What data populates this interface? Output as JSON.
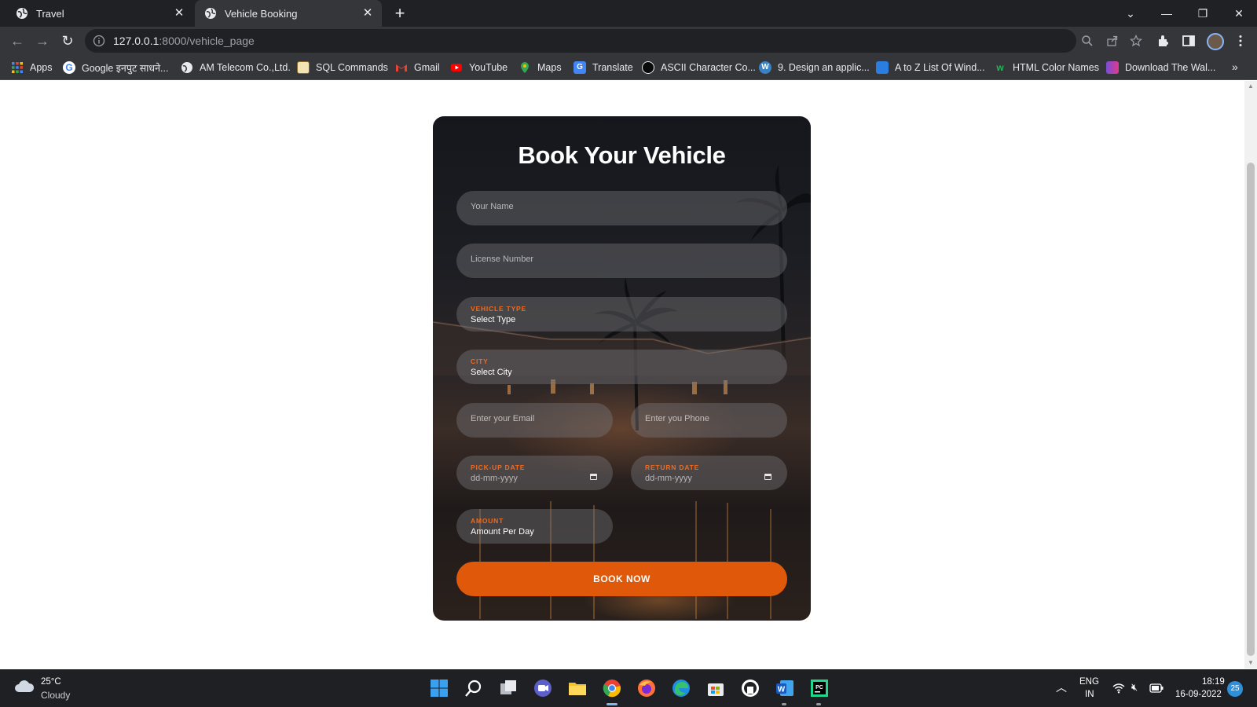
{
  "browser": {
    "tabs": [
      {
        "title": "Travel",
        "active": false
      },
      {
        "title": "Vehicle Booking",
        "active": true
      }
    ],
    "address": {
      "host": "127.0.0.1",
      "path": ":8000/vehicle_page"
    },
    "bookmarks": [
      {
        "label": "Apps",
        "color": "#4285f4"
      },
      {
        "label": "Google इनपुट साधने...",
        "color": "#ea4335"
      },
      {
        "label": "AM Telecom Co.,Ltd.",
        "color": "#e8eaed"
      },
      {
        "label": "SQL Commands",
        "color": "#e0a030"
      },
      {
        "label": "Gmail",
        "color": "#ea4335"
      },
      {
        "label": "YouTube",
        "color": "#ff0000"
      },
      {
        "label": "Maps",
        "color": "#34a853"
      },
      {
        "label": "Translate",
        "color": "#4285f4"
      },
      {
        "label": "ASCII Character Co...",
        "color": "#111111"
      },
      {
        "label": "9. Design an applic...",
        "color": "#3b82c4"
      },
      {
        "label": "A to Z List Of Wind...",
        "color": "#2a7de1"
      },
      {
        "label": "HTML Color Names",
        "color": "#1db954"
      },
      {
        "label": "Download The Wal...",
        "color": "#7a4dd8"
      }
    ]
  },
  "form": {
    "title": "Book Your Vehicle",
    "name_placeholder": "Your Name",
    "license_placeholder": "License Number",
    "vehicle_type": {
      "label": "VEHICLE TYPE",
      "value": "Select Type"
    },
    "city": {
      "label": "CITY",
      "value": "Select City"
    },
    "email_placeholder": "Enter your Email",
    "phone_placeholder": "Enter you Phone",
    "pickup_date": {
      "label": "PICK-UP DATE",
      "value": "dd-mm-yyyy"
    },
    "return_date": {
      "label": "RETURN DATE",
      "value": "dd-mm-yyyy"
    },
    "amount": {
      "label": "AMOUNT",
      "value": "Amount Per Day"
    },
    "submit_label": "BOOK NOW",
    "accent_color": "#e0590b"
  },
  "taskbar": {
    "weather": {
      "temp": "25°C",
      "condition": "Cloudy"
    },
    "language": {
      "line1": "ENG",
      "line2": "IN"
    },
    "clock": {
      "time": "18:19",
      "date": "16-09-2022"
    },
    "notifications": "25"
  }
}
